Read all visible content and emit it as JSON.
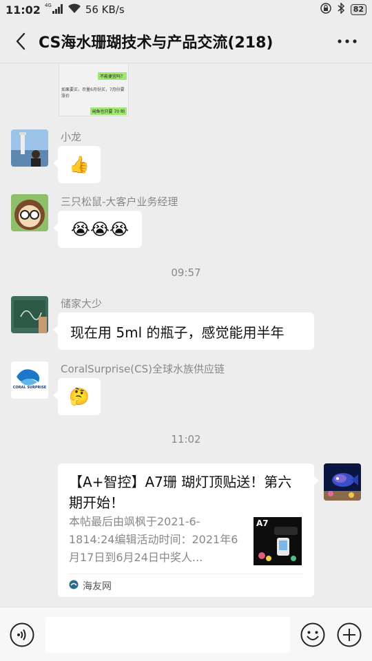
{
  "status_bar": {
    "time": "11:02",
    "network_label": "4G",
    "speed": "56 KB/s",
    "battery": "82"
  },
  "header": {
    "title": "CS海水珊瑚技术与产品交流(218)"
  },
  "shot_texts": {
    "line1": "不能便宜吗？",
    "line2": "如果要买，尽量6月份买，7月份要涨价",
    "line3": "闲鱼也只要 70 哟"
  },
  "messages": [
    {
      "sender": "小龙",
      "content": "👍"
    },
    {
      "sender": "三只松鼠-大客户业务经理",
      "content": "😭😭😭"
    },
    {
      "sender": "储家大少",
      "content": "现在用 5ml 的瓶子，感觉能用半年"
    },
    {
      "sender": "CoralSurprise(CS)全球水族供应链",
      "content": "🤔"
    }
  ],
  "timestamps": [
    "09:57",
    "11:02"
  ],
  "link_card": {
    "title": "【A+智控】A7珊 瑚灯顶贴送！第六期开始！",
    "description": "本帖最后由飒枫于2021-6-1814:24编辑活动时间：2021年6月17日到6月24日中奖人...",
    "thumb_label": "A7",
    "source": "海友网"
  },
  "cs_logo_text": "CORAL SURPRISE",
  "colors": {
    "background": "#ededed",
    "bubble": "#ffffff",
    "meta_text": "#888888"
  },
  "input": {
    "placeholder": ""
  }
}
